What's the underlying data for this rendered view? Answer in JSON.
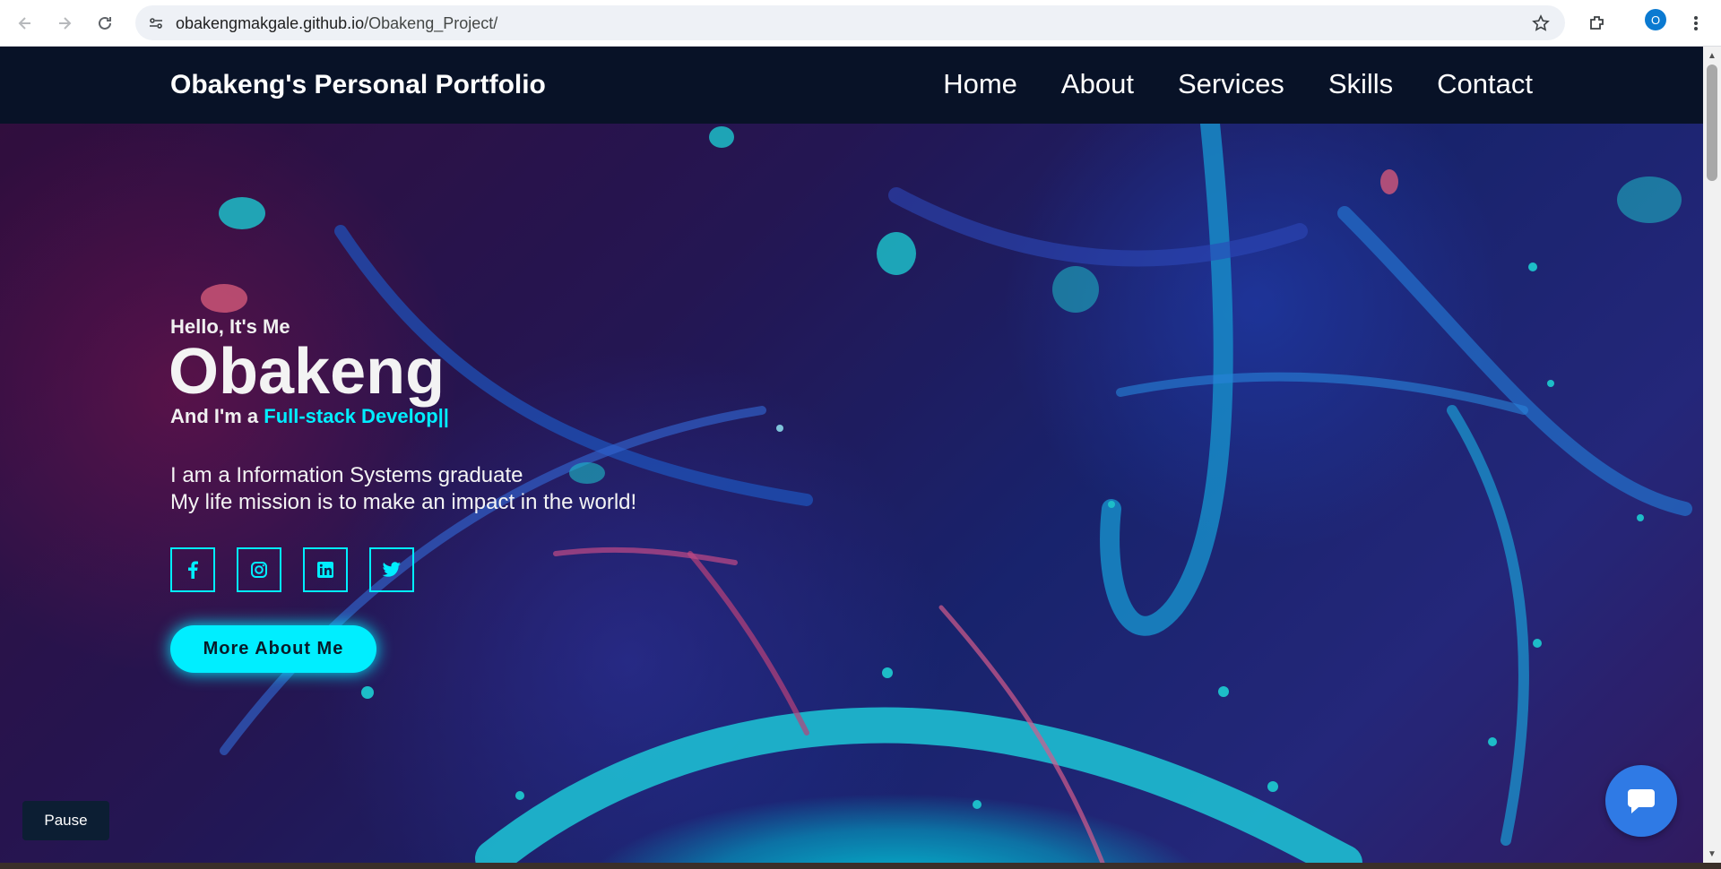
{
  "browser": {
    "url_host": "obakengmakgale.github.io",
    "url_path": "/Obakeng_Project/",
    "profile_initial": "O"
  },
  "site": {
    "logo": "Obakeng's Personal Portfolio",
    "nav": [
      "Home",
      "About",
      "Services",
      "Skills",
      "Contact"
    ]
  },
  "hero": {
    "greeting": "Hello, It's Me",
    "name": "Obakeng",
    "role_prefix": "And I'm a ",
    "role_typed": "Full-stack Develop||",
    "description_line1": "I am a Information Systems graduate",
    "description_line2": "My life mission is to make an impact in the world!",
    "socials": [
      "facebook-icon",
      "instagram-icon",
      "linkedin-icon",
      "twitter-icon"
    ],
    "cta_label": "More About Me"
  },
  "controls": {
    "pause_label": "Pause"
  },
  "colors": {
    "accent": "#00eeff",
    "header_bg": "#081227",
    "chat_button": "#2f7ae5"
  }
}
